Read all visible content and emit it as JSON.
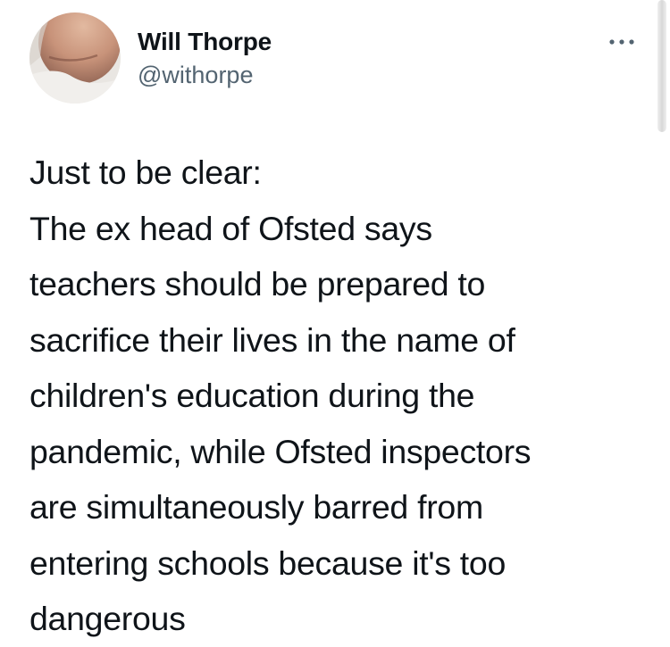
{
  "author": {
    "name": "Will Thorpe",
    "handle": "@withorpe"
  },
  "tweet": {
    "lines": [
      "Just to be clear:",
      "The ex head of Ofsted says",
      "teachers should be prepared to",
      "sacrifice their lives in the name of",
      "children's education during the",
      "pandemic, while Ofsted inspectors",
      "are simultaneously barred from",
      "entering schools because it's too",
      "dangerous"
    ]
  },
  "icons": {
    "avatar": "profile-photo",
    "more": "more-options-dots-icon"
  },
  "colors": {
    "text": "#0f1419",
    "secondary_text": "#536471",
    "background": "#ffffff"
  }
}
